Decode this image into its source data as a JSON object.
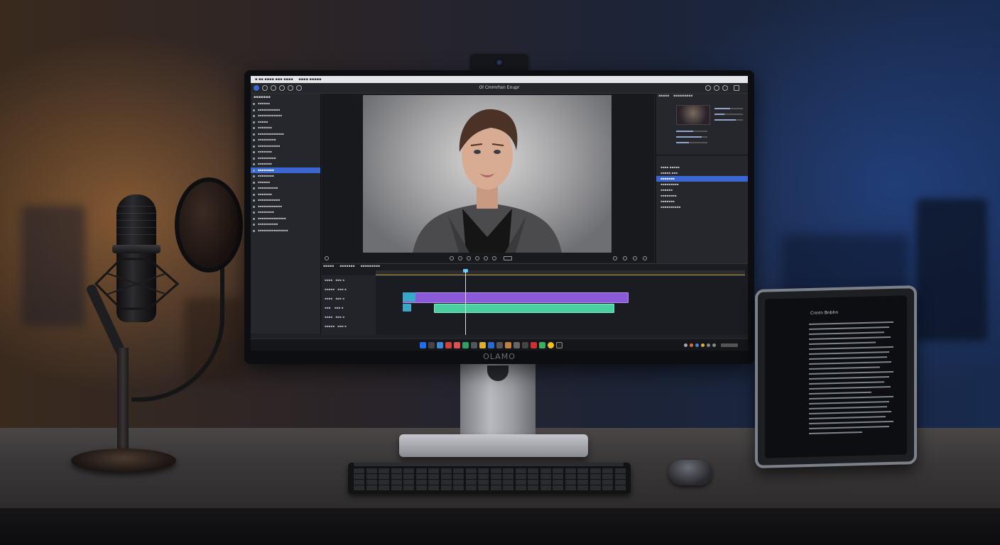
{
  "screen": {
    "app_title": "Ol Cmmrhsn Enupr",
    "chin_logo": "OLAMO"
  },
  "tablet": {
    "title": "Cnnrn Bnbhn"
  },
  "colors": {
    "selection": "#3b67d2",
    "clip_purple": "#8a5ad8",
    "clip_green": "#4ad0a0",
    "clip_teal": "#3aa6c8",
    "warm_light": "#c48040",
    "cool_light": "#2a50a0"
  }
}
